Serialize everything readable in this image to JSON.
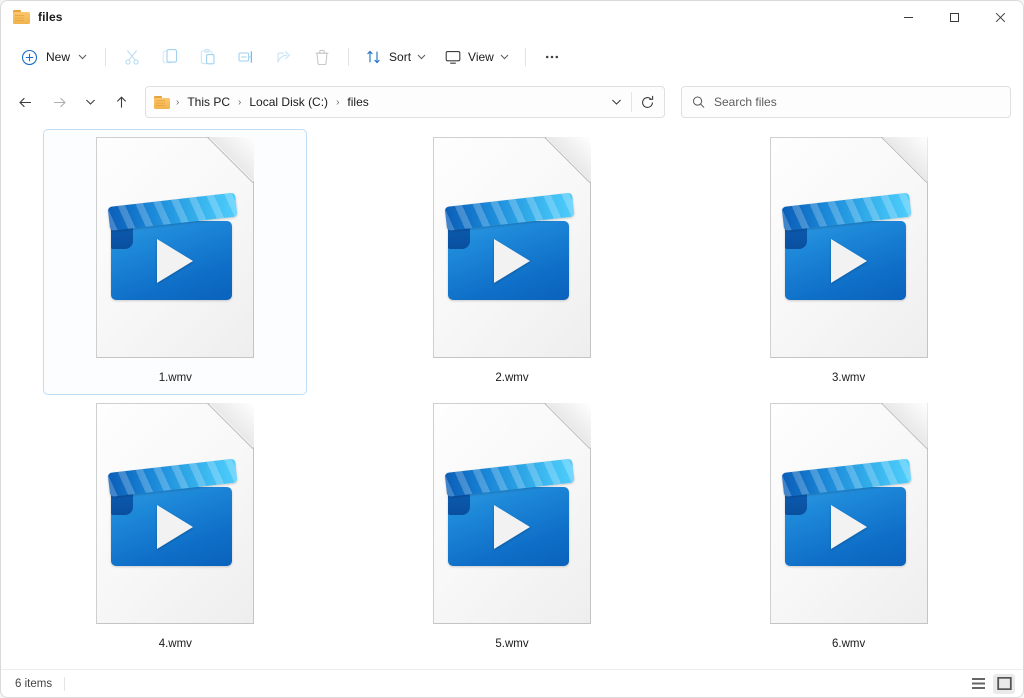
{
  "window": {
    "title": "files",
    "folder_icon": "folder-icon",
    "controls": {
      "minimize": "minimize-icon",
      "maximize": "maximize-icon",
      "close": "close-icon"
    }
  },
  "toolbar": {
    "new_label": "New",
    "new_icon": "plus-circle-icon",
    "cut_icon": "scissors-icon",
    "copy_icon": "copy-icon",
    "paste_icon": "paste-icon",
    "rename_icon": "rename-icon",
    "share_icon": "share-icon",
    "delete_icon": "trash-icon",
    "sort_label": "Sort",
    "sort_icon": "sort-arrows-icon",
    "view_label": "View",
    "view_icon": "monitor-icon",
    "more_label": "•••",
    "chevron": ""
  },
  "navigation": {
    "back_icon": "arrow-left-icon",
    "forward_icon": "arrow-right-icon",
    "recent_icon": "chevron-down-icon",
    "up_icon": "arrow-up-icon",
    "refresh_icon": "refresh-icon",
    "address_chevron_icon": "chevron-down-icon"
  },
  "breadcrumb": {
    "icon": "folder-icon",
    "separator": "›",
    "items": [
      {
        "label": "This PC"
      },
      {
        "label": "Local Disk (C:)"
      },
      {
        "label": "files"
      }
    ]
  },
  "search": {
    "placeholder": "Search files",
    "value": "",
    "icon": "search-icon"
  },
  "files": [
    {
      "name": "1.wmv",
      "type": "wmv",
      "selected": true
    },
    {
      "name": "2.wmv",
      "type": "wmv",
      "selected": false
    },
    {
      "name": "3.wmv",
      "type": "wmv",
      "selected": false
    },
    {
      "name": "4.wmv",
      "type": "wmv",
      "selected": false
    },
    {
      "name": "5.wmv",
      "type": "wmv",
      "selected": false
    },
    {
      "name": "6.wmv",
      "type": "wmv",
      "selected": false
    }
  ],
  "status": {
    "item_count": "6 items",
    "details_view_icon": "list-view-icon",
    "large_icons_view_icon": "large-icons-view-icon"
  },
  "colors": {
    "accent": "#0f6fc8",
    "selection_border": "#bfdef5",
    "selection_fill": "#fbfdff",
    "folder_yellow": "#f0b44e",
    "disabled_icon": "#b9dcf5",
    "window_bg": "#ffffff"
  }
}
